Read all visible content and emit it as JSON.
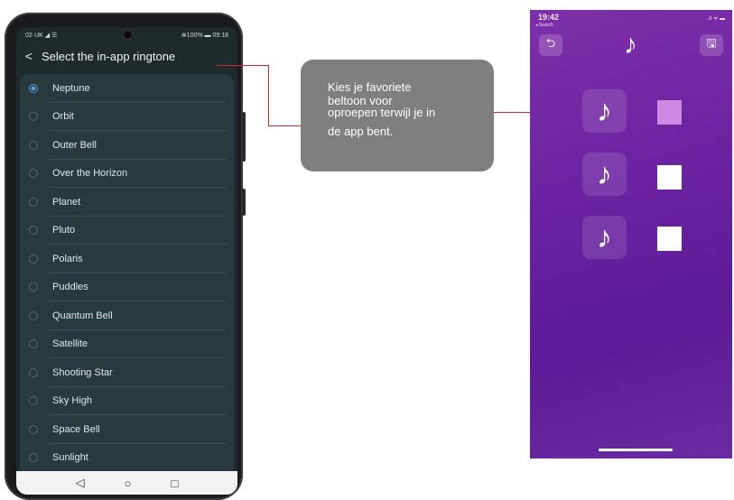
{
  "android": {
    "status_left": "02·UK ◢ ☰",
    "status_right": "⊗100% ▬ 09:18",
    "title": "Select the in-app ringtone",
    "back_glyph": "<",
    "ringtones": [
      {
        "label": "Neptune",
        "selected": true
      },
      {
        "label": "Orbit"
      },
      {
        "label": "Outer Bell"
      },
      {
        "label": "Over the Horizon"
      },
      {
        "label": "Planet"
      },
      {
        "label": "Pluto"
      },
      {
        "label": "Polaris"
      },
      {
        "label": "Puddles"
      },
      {
        "label": "Quantum Bell"
      },
      {
        "label": "Satellite"
      },
      {
        "label": "Shooting Star"
      },
      {
        "label": "Sky High"
      },
      {
        "label": "Space Bell"
      },
      {
        "label": "Sunlight"
      }
    ],
    "nav": {
      "back": "◁",
      "home": "○",
      "recents": "□"
    }
  },
  "callout": {
    "line1": "Kies je favoriete",
    "line2": "beltoon voor",
    "line3": "oproepen terwijl je in",
    "line4": "de app bent."
  },
  "ios": {
    "time": "19:42",
    "back_to": "◂ Search",
    "status_right": ".ıl ᯤ ▬",
    "back_icon": "⮌",
    "save_icon": "🖫",
    "title_icon": "♪",
    "tiles": [
      {
        "icon": "♪",
        "selected": true
      },
      {
        "icon": "♪",
        "selected": false
      },
      {
        "icon": "♪",
        "selected": false
      }
    ],
    "colors": {
      "bg_top": "#7f2fa9",
      "selected": "#d389e4",
      "accent_line": "#cc2a2a"
    }
  }
}
